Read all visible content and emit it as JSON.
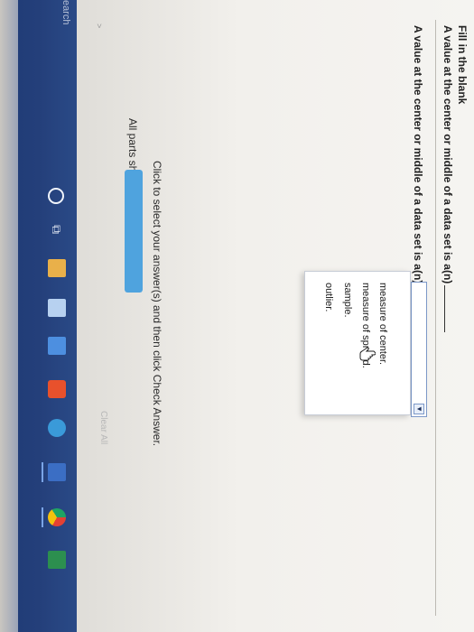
{
  "question": {
    "heading": "Fill in the blank",
    "line1": "A value at the center or middle of a data set is a(n)",
    "line2": "A value at the center or middle of a data set is a(n)"
  },
  "select": {
    "selected": "",
    "arrow_icon": "triangle-down-icon",
    "options": [
      "measure of center.",
      "measure of spread.",
      "sample.",
      "outlier."
    ]
  },
  "instruction": "Click to select your answer(s) and then click Check Answer.",
  "parts": {
    "label": "All parts showing",
    "progress": 1.0
  },
  "clear_all": "Clear All",
  "taskbar": {
    "search": "earch",
    "icons": [
      "cortana-icon",
      "task-view-icon",
      "file-explorer-icon",
      "store-icon",
      "mail-icon",
      "office-icon",
      "edge-icon",
      "word-icon",
      "chrome-icon",
      "excel-icon"
    ]
  },
  "colors": {
    "progress_fill": "#4fa3de",
    "progress_track": "#d8e6f3",
    "select_border": "#7c98c8",
    "taskbar": "#243f7a"
  }
}
